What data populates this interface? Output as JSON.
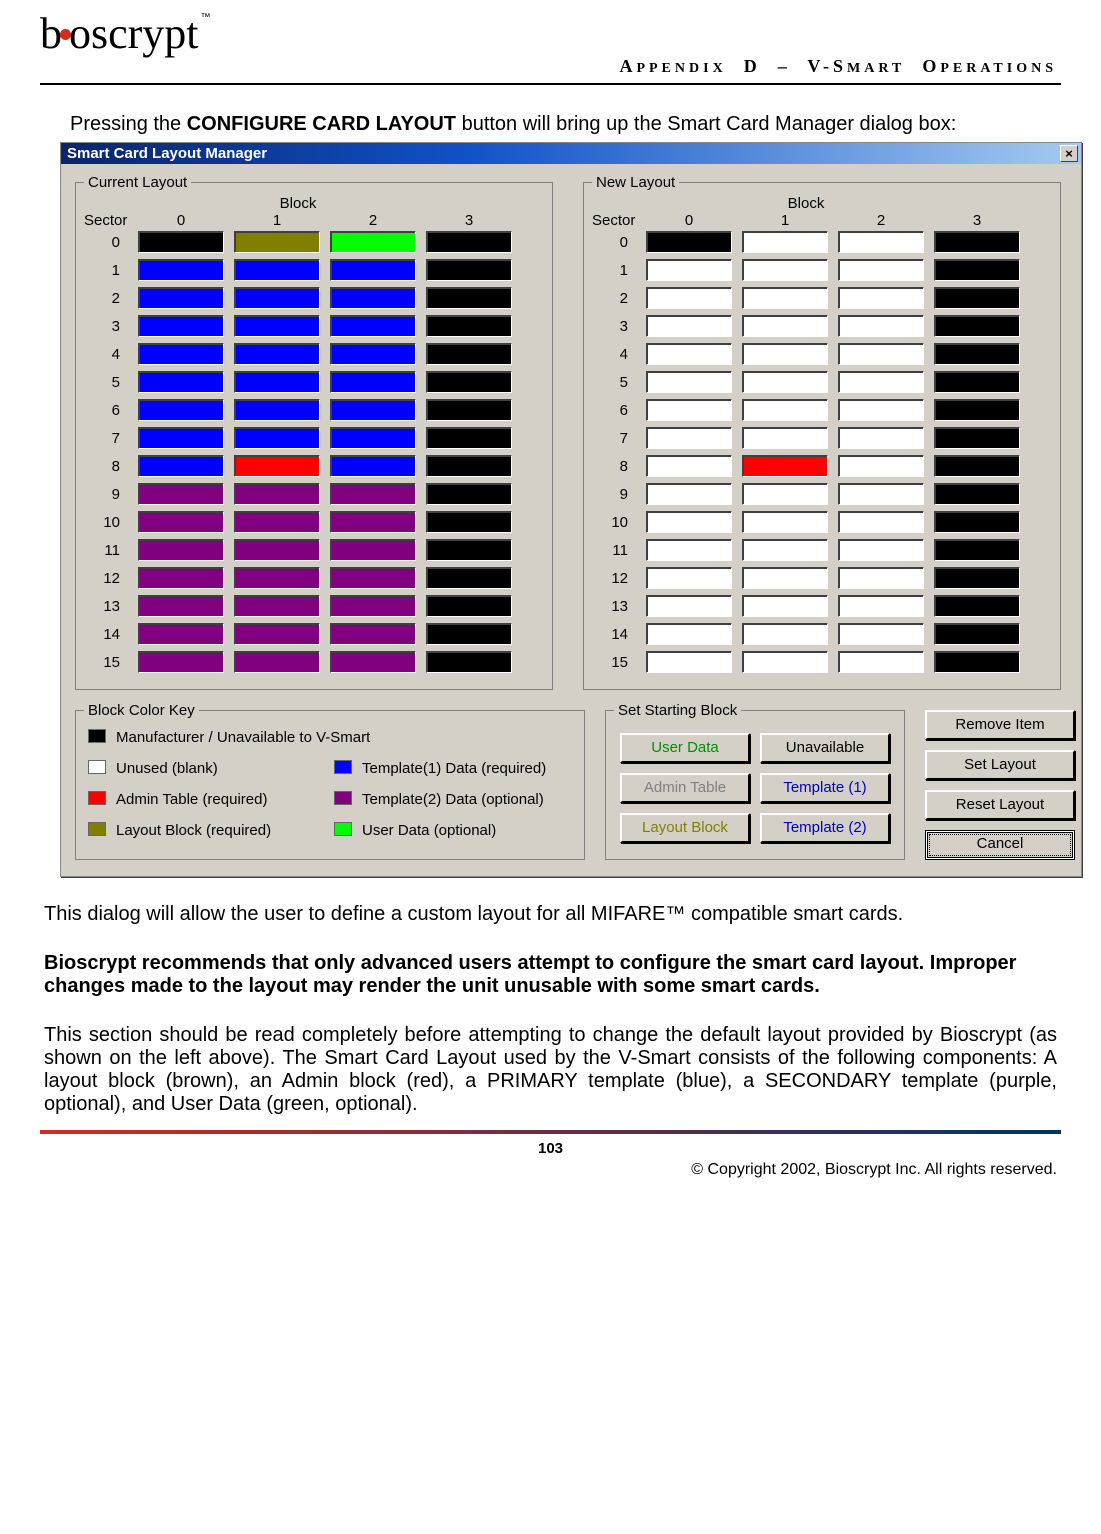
{
  "logo": {
    "text": "bioscrypt",
    "tm": "™"
  },
  "appendix_title_head": "A",
  "appendix_title_rest": "PPENDIX",
  "appendix_d": "D",
  "appendix_sep": "–",
  "appendix_v": "V-S",
  "appendix_mart": "MART",
  "appendix_o": "O",
  "appendix_per": "PERATIONS",
  "intro_pre": "Pressing the ",
  "intro_bold": "CONFIGURE CARD LAYOUT",
  "intro_post": " button will bring up the Smart Card Manager dialog box:",
  "dialog": {
    "title": "Smart Card Layout Manager",
    "close": "×",
    "current_legend": "Current Layout",
    "new_legend": "New Layout",
    "block_label": "Block",
    "sector_label": "Sector",
    "cols": [
      "0",
      "1",
      "2",
      "3"
    ],
    "rows": [
      "0",
      "1",
      "2",
      "3",
      "4",
      "5",
      "6",
      "7",
      "8",
      "9",
      "10",
      "11",
      "12",
      "13",
      "14",
      "15"
    ],
    "key_legend": "Block Color Key",
    "key_items": [
      {
        "color": "c-black",
        "label": "Manufacturer / Unavailable to V-Smart"
      },
      {
        "color": "c-white",
        "label": "Unused (blank)"
      },
      {
        "color": "c-blue",
        "label": "Template(1) Data (required)"
      },
      {
        "color": "c-red",
        "label": "Admin Table (required)"
      },
      {
        "color": "c-purple",
        "label": "Template(2) Data (optional)"
      },
      {
        "color": "c-olive",
        "label": "Layout Block (required)"
      },
      {
        "color": "c-green",
        "label": "User Data (optional)"
      }
    ],
    "start_legend": "Set Starting Block",
    "start_buttons": {
      "user_data": "User Data",
      "unavailable": "Unavailable",
      "admin_table": "Admin Table",
      "template1": "Template (1)",
      "layout_block": "Layout Block",
      "template2": "Template (2)"
    },
    "actions": {
      "remove": "Remove Item",
      "set": "Set Layout",
      "reset": "Reset Layout",
      "cancel": "Cancel"
    }
  },
  "grids": {
    "current": [
      [
        "black",
        "olive",
        "green",
        "black"
      ],
      [
        "blue",
        "blue",
        "blue",
        "black"
      ],
      [
        "blue",
        "blue",
        "blue",
        "black"
      ],
      [
        "blue",
        "blue",
        "blue",
        "black"
      ],
      [
        "blue",
        "blue",
        "blue",
        "black"
      ],
      [
        "blue",
        "blue",
        "blue",
        "black"
      ],
      [
        "blue",
        "blue",
        "blue",
        "black"
      ],
      [
        "blue",
        "blue",
        "blue",
        "black"
      ],
      [
        "blue",
        "red",
        "blue",
        "black"
      ],
      [
        "purple",
        "purple",
        "purple",
        "black"
      ],
      [
        "purple",
        "purple",
        "purple",
        "black"
      ],
      [
        "purple",
        "purple",
        "purple",
        "black"
      ],
      [
        "purple",
        "purple",
        "purple",
        "black"
      ],
      [
        "purple",
        "purple",
        "purple",
        "black"
      ],
      [
        "purple",
        "purple",
        "purple",
        "black"
      ],
      [
        "purple",
        "purple",
        "purple",
        "black"
      ]
    ],
    "new": [
      [
        "black",
        "white",
        "white",
        "black"
      ],
      [
        "white",
        "white",
        "white",
        "black"
      ],
      [
        "white",
        "white",
        "white",
        "black"
      ],
      [
        "white",
        "white",
        "white",
        "black"
      ],
      [
        "white",
        "white",
        "white",
        "black"
      ],
      [
        "white",
        "white",
        "white",
        "black"
      ],
      [
        "white",
        "white",
        "white",
        "black"
      ],
      [
        "white",
        "white",
        "white",
        "black"
      ],
      [
        "white",
        "red",
        "white",
        "black"
      ],
      [
        "white",
        "white",
        "white",
        "black"
      ],
      [
        "white",
        "white",
        "white",
        "black"
      ],
      [
        "white",
        "white",
        "white",
        "black"
      ],
      [
        "white",
        "white",
        "white",
        "black"
      ],
      [
        "white",
        "white",
        "white",
        "black"
      ],
      [
        "white",
        "white",
        "white",
        "black"
      ],
      [
        "white",
        "white",
        "white",
        "black"
      ]
    ]
  },
  "para1": "This dialog will allow the user to define a custom layout for all MIFARE™ compatible smart cards.",
  "para2": "Bioscrypt recommends that only advanced users attempt to configure the smart card layout.  Improper changes made to the layout may render the unit unusable with some smart cards.",
  "para3": "This section should be read completely before attempting to change the default layout provided by Bioscrypt (as shown on the left above).  The Smart Card Layout used by the V-Smart consists of the following components: A layout block (brown), an Admin block (red), a PRIMARY template (blue), a SECONDARY template (purple, optional), and User Data (green, optional).",
  "page_num": "103",
  "copyright": "© Copyright 2002, Bioscrypt Inc.  All rights reserved."
}
